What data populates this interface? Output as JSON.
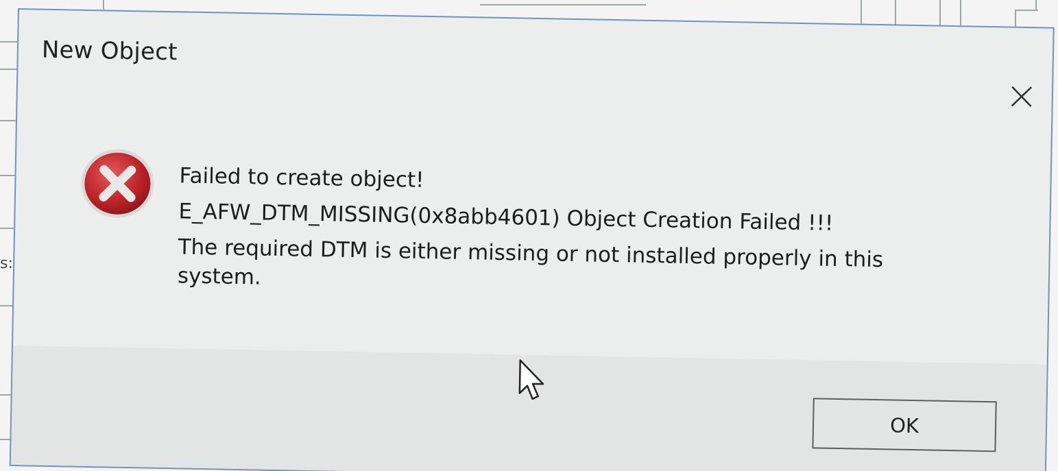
{
  "background": {
    "partial_label": "s:"
  },
  "dialog": {
    "title": "New Object",
    "message_lines": [
      "Failed to create object!",
      "E_AFW_DTM_MISSING(0x8abb4601) Object Creation Failed !!!",
      "The required DTM is  either missing or not installed properly in this",
      "system."
    ],
    "ok_label": "OK",
    "icons": {
      "error": "error-circle-x-icon",
      "close": "close-x-icon",
      "cursor": "mouse-pointer-icon"
    },
    "colors": {
      "error_red": "#c0262b",
      "frame_blue": "#6f93c0"
    }
  }
}
